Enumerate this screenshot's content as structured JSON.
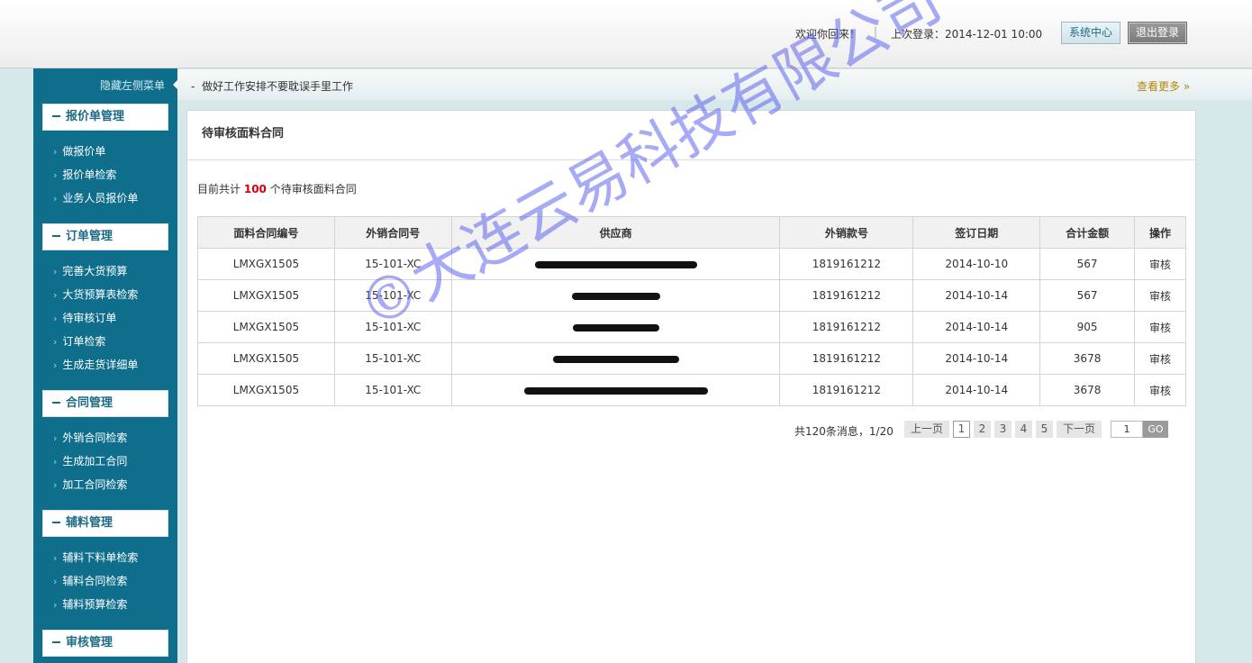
{
  "header": {
    "welcome": "欢迎你回来！",
    "separator": "|",
    "last_login": "上次登录：2014-12-01 10:00",
    "system_center": "系统中心",
    "logout": "退出登录"
  },
  "sidebar": {
    "hide_menu": "隐藏左侧菜单",
    "groups": [
      {
        "title": "报价单管理",
        "items": [
          "做报价单",
          "报价单检索",
          "业务人员报价单"
        ]
      },
      {
        "title": "订单管理",
        "items": [
          "完善大货预算",
          "大货预算表检索",
          "待审核订单",
          "订单检索",
          "生成走货详细单"
        ]
      },
      {
        "title": "合同管理",
        "items": [
          "外销合同检索",
          "生成加工合同",
          "加工合同检索"
        ]
      },
      {
        "title": "辅料管理",
        "items": [
          "辅料下料单检索",
          "辅料合同检索",
          "辅料预算检索"
        ]
      },
      {
        "title": "审核管理",
        "items": []
      }
    ]
  },
  "notice": {
    "dash": "-",
    "message": "做好工作安排不要耽误手里工作",
    "more": "查看更多 »"
  },
  "main": {
    "title": "待审核面料合同",
    "summary_prefix": "目前共计",
    "summary_count": "100",
    "summary_suffix": "个待审核面料合同",
    "columns": [
      "面料合同编号",
      "外销合同号",
      "供应商",
      "外销款号",
      "签订日期",
      "合计金额",
      "操作"
    ],
    "rows": [
      {
        "contract_no": "LMXGX1505",
        "sales_no": "15-101-XC",
        "style_no": "1819161212",
        "date": "2014-10-10",
        "amount": "567",
        "action": "审核"
      },
      {
        "contract_no": "LMXGX1505",
        "sales_no": "15-101-XC",
        "style_no": "1819161212",
        "date": "2014-10-14",
        "amount": "567",
        "action": "审核"
      },
      {
        "contract_no": "LMXGX1505",
        "sales_no": "15-101-XC",
        "style_no": "1819161212",
        "date": "2014-10-14",
        "amount": "905",
        "action": "审核"
      },
      {
        "contract_no": "LMXGX1505",
        "sales_no": "15-101-XC",
        "style_no": "1819161212",
        "date": "2014-10-14",
        "amount": "3678",
        "action": "审核"
      },
      {
        "contract_no": "LMXGX1505",
        "sales_no": "15-101-XC",
        "style_no": "1819161212",
        "date": "2014-10-14",
        "amount": "3678",
        "action": "审核"
      }
    ],
    "pager": {
      "info": "共120条消息，1/20",
      "prev": "上一页",
      "pages": [
        "1",
        "2",
        "3",
        "4",
        "5"
      ],
      "next": "下一页",
      "goto_value": "1",
      "go": "GO"
    }
  },
  "watermark": "©大连云易科技有限公司",
  "colors": {
    "sidebar_bg": "#0e6e8c",
    "accent_text": "#1d6a86",
    "count_red": "#d6000a",
    "more_link": "#b8860b",
    "background": "#d6e8ea"
  }
}
